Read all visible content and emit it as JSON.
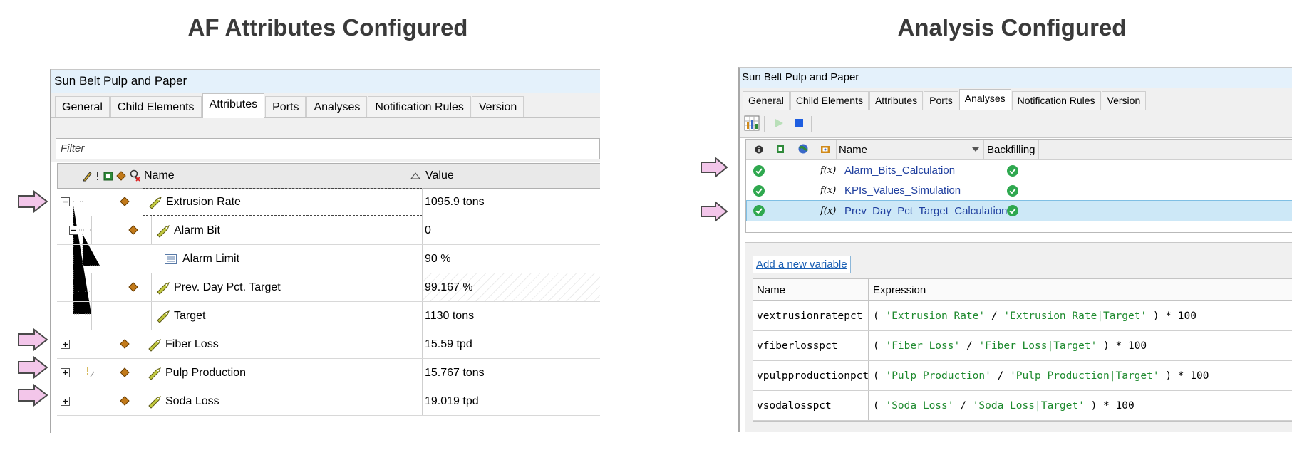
{
  "headings": {
    "left": "AF Attributes Configured",
    "right": "Analysis Configured"
  },
  "left_panel": {
    "title": "Sun Belt Pulp and Paper",
    "tabs": [
      "General",
      "Child Elements",
      "Attributes",
      "Ports",
      "Analyses",
      "Notification Rules",
      "Version"
    ],
    "active_tab": "Attributes",
    "filter_placeholder": "Filter",
    "columns": {
      "name": "Name",
      "value": "Value"
    },
    "rows": [
      {
        "name": "Extrusion Rate",
        "value": "1095.9 tons",
        "expand": "−"
      },
      {
        "name": "Alarm Bit",
        "value": "0",
        "expand": "−"
      },
      {
        "name": "Alarm Limit",
        "value": "90 %"
      },
      {
        "name": "Prev. Day Pct. Target",
        "value": "99.167 %"
      },
      {
        "name": "Target",
        "value": "1130 tons"
      },
      {
        "name": "Fiber Loss",
        "value": "15.59 tpd",
        "expand": "+"
      },
      {
        "name": "Pulp Production",
        "value": "15.767 tons",
        "expand": "+"
      },
      {
        "name": "Soda Loss",
        "value": "19.019 tpd",
        "expand": "+"
      }
    ]
  },
  "right_panel": {
    "title": "Sun Belt Pulp and Paper",
    "tabs": [
      "General",
      "Child Elements",
      "Attributes",
      "Ports",
      "Analyses",
      "Notification Rules",
      "Version"
    ],
    "active_tab": "Analyses",
    "columns": {
      "name": "Name",
      "backfilling": "Backfilling"
    },
    "analyses": [
      {
        "name": "Alarm_Bits_Calculation"
      },
      {
        "name": "KPIs_Values_Simulation"
      },
      {
        "name": "Prev_Day_Pct_Target_Calculation",
        "selected": true
      }
    ],
    "add_variable": "Add a new variable",
    "var_columns": {
      "name": "Name",
      "expression": "Expression"
    },
    "variables": [
      {
        "name": "vextrusionratepct",
        "open": "( ",
        "a": "'Extrusion Rate'",
        "op": " / ",
        "b": "'Extrusion Rate|Target'",
        "close": " ) * 100"
      },
      {
        "name": "vfiberlosspct",
        "open": "( ",
        "a": "'Fiber Loss'",
        "op": " / ",
        "b": "'Fiber Loss|Target'",
        "close": " ) * 100"
      },
      {
        "name": "vpulpproductionpct",
        "open": "( ",
        "a": "'Pulp Production'",
        "op": " / ",
        "b": "'Pulp Production|Target'",
        "close": " ) * 100"
      },
      {
        "name": "vsodalosspct",
        "open": "( ",
        "a": "'Soda Loss'",
        "op": " / ",
        "b": "'Soda Loss|Target'",
        "close": " ) * 100"
      }
    ],
    "fx_glyph": "f(x)"
  },
  "colors": {
    "arrow_fill": "#f3c6ea",
    "arrow_stroke": "#4a4a4a",
    "check_green": "#2fa84f",
    "title_bar": "#e4f1fb",
    "selection": "#cde8f7"
  }
}
